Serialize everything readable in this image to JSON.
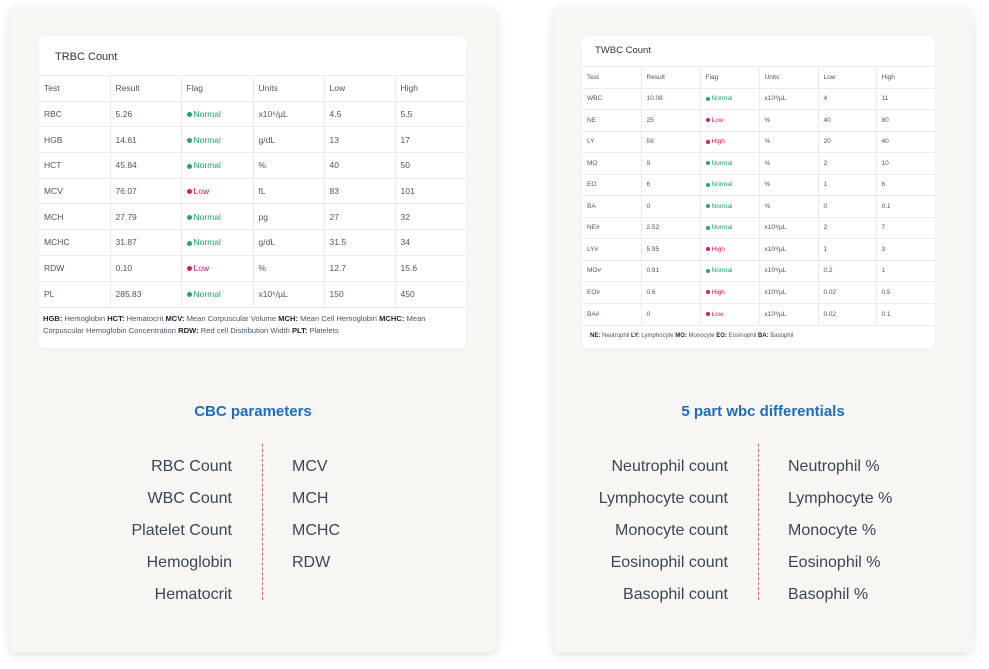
{
  "trbc": {
    "title": "TRBC Count",
    "headers": [
      "Test",
      "Result",
      "Flag",
      "Units",
      "Low",
      "High"
    ],
    "rows": [
      {
        "test": "RBC",
        "result": "5.26",
        "flag": "Normal",
        "units": "x10⁶/µL",
        "low": "4.5",
        "high": "5.5"
      },
      {
        "test": "HGB",
        "result": "14.61",
        "flag": "Normal",
        "units": "g/dL",
        "low": "13",
        "high": "17"
      },
      {
        "test": "HCT",
        "result": "45.84",
        "flag": "Normal",
        "units": "%",
        "low": "40",
        "high": "50"
      },
      {
        "test": "MCV",
        "result": "76.07",
        "flag": "Low",
        "units": "fL",
        "low": "83",
        "high": "101"
      },
      {
        "test": "MCH",
        "result": "27.79",
        "flag": "Normal",
        "units": "pg",
        "low": "27",
        "high": "32"
      },
      {
        "test": "MCHC",
        "result": "31.87",
        "flag": "Normal",
        "units": "g/dL",
        "low": "31.5",
        "high": "34"
      },
      {
        "test": "RDW",
        "result": "0.10",
        "flag": "Low",
        "units": "%",
        "low": "12.7",
        "high": "15.6"
      },
      {
        "test": "PL",
        "result": "285.83",
        "flag": "Normal",
        "units": "x10⁶/µL",
        "low": "150",
        "high": "450"
      }
    ],
    "legend": [
      {
        "abbr": "HGB:",
        "full": "Hemoglobin"
      },
      {
        "abbr": "HCT:",
        "full": "Hematocrit"
      },
      {
        "abbr": "MCV:",
        "full": "Mean Corpuscular Volume"
      },
      {
        "abbr": "MCH:",
        "full": "Mean Cell Hemoglobin"
      },
      {
        "abbr": "MCHC:",
        "full": "Mean Corpuscular Hemoglobin Concentration"
      },
      {
        "abbr": "RDW:",
        "full": "Red cell Distribution Width"
      },
      {
        "abbr": "PLT:",
        "full": "Platelets"
      }
    ]
  },
  "twbc": {
    "title": "TWBC Count",
    "headers": [
      "Test",
      "Result",
      "Flag",
      "Units",
      "Low",
      "High"
    ],
    "rows": [
      {
        "test": "WBC",
        "result": "10.08",
        "flag": "Normal",
        "units": "x10³/µL",
        "low": "4",
        "high": "11"
      },
      {
        "test": "NE",
        "result": "25",
        "flag": "Low",
        "units": "%",
        "low": "40",
        "high": "80"
      },
      {
        "test": "LY",
        "result": "59",
        "flag": "High",
        "units": "%",
        "low": "20",
        "high": "40"
      },
      {
        "test": "MO",
        "result": "9",
        "flag": "Normal",
        "units": "%",
        "low": "2",
        "high": "10"
      },
      {
        "test": "EO",
        "result": "6",
        "flag": "Normal",
        "units": "%",
        "low": "1",
        "high": "6"
      },
      {
        "test": "BA",
        "result": "0",
        "flag": "Normal",
        "units": "%",
        "low": "0",
        "high": "0.1"
      },
      {
        "test": "NE#",
        "result": "2.52",
        "flag": "Normal",
        "units": "x10³/µL",
        "low": "2",
        "high": "7"
      },
      {
        "test": "LY#",
        "result": "5.95",
        "flag": "High",
        "units": "x10³/µL",
        "low": "1",
        "high": "3"
      },
      {
        "test": "MO#",
        "result": "0.91",
        "flag": "Normal",
        "units": "x10³/µL",
        "low": "0.2",
        "high": "1"
      },
      {
        "test": "EO#",
        "result": "0.6",
        "flag": "High",
        "units": "x10³/µL",
        "low": "0.02",
        "high": "0.5"
      },
      {
        "test": "BA#",
        "result": "0",
        "flag": "Low",
        "units": "x10³/µL",
        "low": "0.02",
        "high": "0.1"
      }
    ],
    "legend": [
      {
        "abbr": "NE:",
        "full": "Neutrophil"
      },
      {
        "abbr": "LY:",
        "full": "Lymphocyte"
      },
      {
        "abbr": "MO:",
        "full": "Monocyte"
      },
      {
        "abbr": "EO:",
        "full": "Eosinophil"
      },
      {
        "abbr": "BA:",
        "full": "Basophil"
      }
    ]
  },
  "cbc": {
    "title": "CBC parameters",
    "left": [
      "RBC Count",
      "WBC Count",
      "Platelet Count",
      "Hemoglobin",
      "Hematocrit"
    ],
    "right": [
      "MCV",
      "MCH",
      "MCHC",
      "RDW"
    ]
  },
  "wbc_diff": {
    "title": "5 part wbc differentials",
    "left": [
      "Neutrophil count",
      "Lymphocyte count",
      "Monocyte count",
      "Eosinophil count",
      "Basophil count"
    ],
    "right": [
      "Neutrophil %",
      "Lymphocyte %",
      "Monocyte %",
      "Eosinophil %",
      "Basophil %"
    ]
  },
  "colors": {
    "normal": "#1ea76b",
    "low": "#e0195b",
    "high": "#e0195b",
    "accent": "#1d6dc4"
  }
}
